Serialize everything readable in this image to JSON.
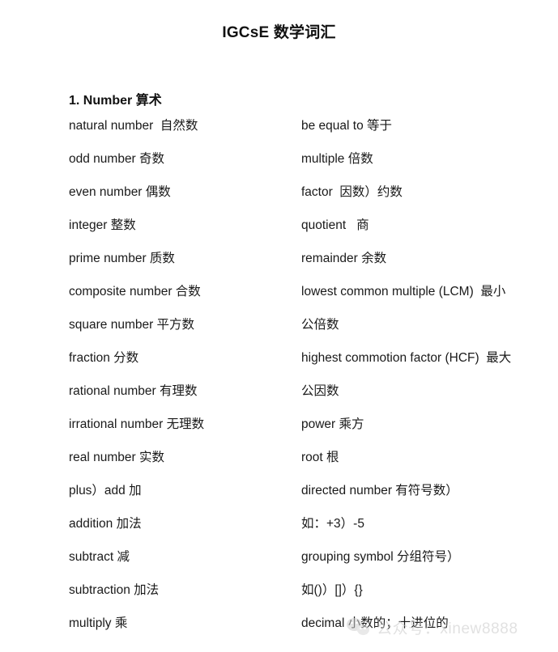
{
  "document": {
    "title": "IGCsE 数学词汇",
    "section_heading": "1. Number 算术"
  },
  "glossary": {
    "left_column": [
      {
        "text": "natural number  自然数"
      },
      {
        "text": "odd number 奇数"
      },
      {
        "text": "even number 偶数"
      },
      {
        "text": "integer 整数"
      },
      {
        "text": "prime number 质数"
      },
      {
        "text": "composite number 合数"
      },
      {
        "text": "square number 平方数"
      },
      {
        "text": "fraction 分数"
      },
      {
        "text": "rational number 有理数"
      },
      {
        "text": "irrational number 无理数"
      },
      {
        "text": "real number 实数"
      },
      {
        "text": "plus）add 加"
      },
      {
        "text": "addition 加法"
      },
      {
        "text": "subtract 减"
      },
      {
        "text": "subtraction 加法"
      },
      {
        "text": "multiply 乘"
      }
    ],
    "right_column": [
      {
        "text": "be equal to 等于"
      },
      {
        "text": "multiple 倍数"
      },
      {
        "text": "factor  因数）约数"
      },
      {
        "text": "quotient   商"
      },
      {
        "text": "remainder 余数"
      },
      {
        "text": "lowest common multiple (LCM)  最小"
      },
      {
        "text": "公倍数"
      },
      {
        "text": "highest commotion factor (HCF)  最大"
      },
      {
        "text": "公因数"
      },
      {
        "text": "power 乘方"
      },
      {
        "text": "root 根"
      },
      {
        "text": "directed number 有符号数）"
      },
      {
        "text": "如：+3）-5"
      },
      {
        "text": "grouping symbol 分组符号）"
      },
      {
        "text": "如()）[]）{}"
      },
      {
        "text": "decimal 小数的；十进位的"
      }
    ]
  },
  "watermark": {
    "text": "公众号：xinew8888",
    "icon": "wechat-icon",
    "color": "#c9c9c9"
  }
}
